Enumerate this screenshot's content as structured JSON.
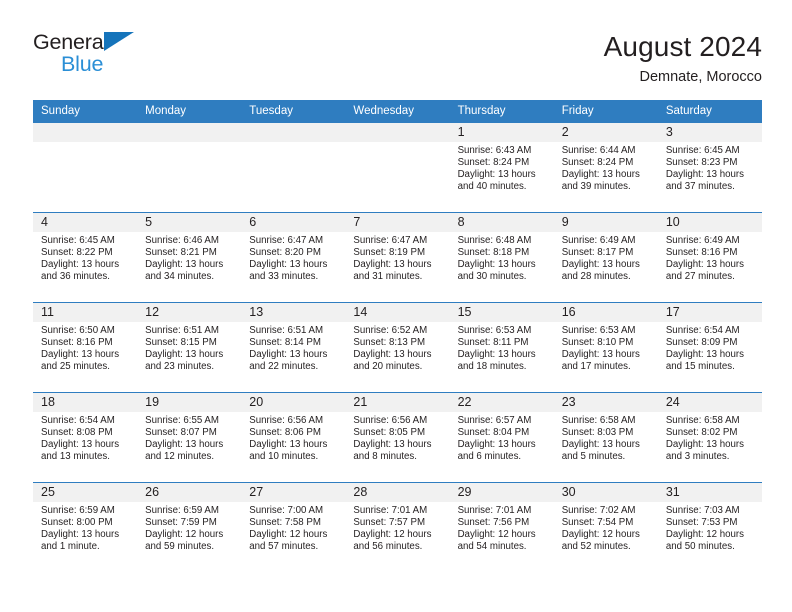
{
  "brand": {
    "name_part1": "General",
    "name_part2": "Blue",
    "triangle_color": "#1574bb",
    "blue_color": "#2b8fd6"
  },
  "header": {
    "title": "August 2024",
    "subtitle": "Demnate, Morocco"
  },
  "theme": {
    "header_bg": "#2f7dc0",
    "daynum_bg": "#f1f1f1",
    "text": "#231f20"
  },
  "weekday_headers": [
    "Sunday",
    "Monday",
    "Tuesday",
    "Wednesday",
    "Thursday",
    "Friday",
    "Saturday"
  ],
  "labels": {
    "sunrise": "Sunrise:",
    "sunset": "Sunset:",
    "daylight": "Daylight:"
  },
  "weeks": [
    [
      {
        "day": "",
        "empty": true
      },
      {
        "day": "",
        "empty": true
      },
      {
        "day": "",
        "empty": true
      },
      {
        "day": "",
        "empty": true
      },
      {
        "day": "1",
        "sunrise": "Sunrise: 6:43 AM",
        "sunset": "Sunset: 8:24 PM",
        "daylight1": "Daylight: 13 hours",
        "daylight2": "and 40 minutes."
      },
      {
        "day": "2",
        "sunrise": "Sunrise: 6:44 AM",
        "sunset": "Sunset: 8:24 PM",
        "daylight1": "Daylight: 13 hours",
        "daylight2": "and 39 minutes."
      },
      {
        "day": "3",
        "sunrise": "Sunrise: 6:45 AM",
        "sunset": "Sunset: 8:23 PM",
        "daylight1": "Daylight: 13 hours",
        "daylight2": "and 37 minutes."
      }
    ],
    [
      {
        "day": "4",
        "sunrise": "Sunrise: 6:45 AM",
        "sunset": "Sunset: 8:22 PM",
        "daylight1": "Daylight: 13 hours",
        "daylight2": "and 36 minutes."
      },
      {
        "day": "5",
        "sunrise": "Sunrise: 6:46 AM",
        "sunset": "Sunset: 8:21 PM",
        "daylight1": "Daylight: 13 hours",
        "daylight2": "and 34 minutes."
      },
      {
        "day": "6",
        "sunrise": "Sunrise: 6:47 AM",
        "sunset": "Sunset: 8:20 PM",
        "daylight1": "Daylight: 13 hours",
        "daylight2": "and 33 minutes."
      },
      {
        "day": "7",
        "sunrise": "Sunrise: 6:47 AM",
        "sunset": "Sunset: 8:19 PM",
        "daylight1": "Daylight: 13 hours",
        "daylight2": "and 31 minutes."
      },
      {
        "day": "8",
        "sunrise": "Sunrise: 6:48 AM",
        "sunset": "Sunset: 8:18 PM",
        "daylight1": "Daylight: 13 hours",
        "daylight2": "and 30 minutes."
      },
      {
        "day": "9",
        "sunrise": "Sunrise: 6:49 AM",
        "sunset": "Sunset: 8:17 PM",
        "daylight1": "Daylight: 13 hours",
        "daylight2": "and 28 minutes."
      },
      {
        "day": "10",
        "sunrise": "Sunrise: 6:49 AM",
        "sunset": "Sunset: 8:16 PM",
        "daylight1": "Daylight: 13 hours",
        "daylight2": "and 27 minutes."
      }
    ],
    [
      {
        "day": "11",
        "sunrise": "Sunrise: 6:50 AM",
        "sunset": "Sunset: 8:16 PM",
        "daylight1": "Daylight: 13 hours",
        "daylight2": "and 25 minutes."
      },
      {
        "day": "12",
        "sunrise": "Sunrise: 6:51 AM",
        "sunset": "Sunset: 8:15 PM",
        "daylight1": "Daylight: 13 hours",
        "daylight2": "and 23 minutes."
      },
      {
        "day": "13",
        "sunrise": "Sunrise: 6:51 AM",
        "sunset": "Sunset: 8:14 PM",
        "daylight1": "Daylight: 13 hours",
        "daylight2": "and 22 minutes."
      },
      {
        "day": "14",
        "sunrise": "Sunrise: 6:52 AM",
        "sunset": "Sunset: 8:13 PM",
        "daylight1": "Daylight: 13 hours",
        "daylight2": "and 20 minutes."
      },
      {
        "day": "15",
        "sunrise": "Sunrise: 6:53 AM",
        "sunset": "Sunset: 8:11 PM",
        "daylight1": "Daylight: 13 hours",
        "daylight2": "and 18 minutes."
      },
      {
        "day": "16",
        "sunrise": "Sunrise: 6:53 AM",
        "sunset": "Sunset: 8:10 PM",
        "daylight1": "Daylight: 13 hours",
        "daylight2": "and 17 minutes."
      },
      {
        "day": "17",
        "sunrise": "Sunrise: 6:54 AM",
        "sunset": "Sunset: 8:09 PM",
        "daylight1": "Daylight: 13 hours",
        "daylight2": "and 15 minutes."
      }
    ],
    [
      {
        "day": "18",
        "sunrise": "Sunrise: 6:54 AM",
        "sunset": "Sunset: 8:08 PM",
        "daylight1": "Daylight: 13 hours",
        "daylight2": "and 13 minutes."
      },
      {
        "day": "19",
        "sunrise": "Sunrise: 6:55 AM",
        "sunset": "Sunset: 8:07 PM",
        "daylight1": "Daylight: 13 hours",
        "daylight2": "and 12 minutes."
      },
      {
        "day": "20",
        "sunrise": "Sunrise: 6:56 AM",
        "sunset": "Sunset: 8:06 PM",
        "daylight1": "Daylight: 13 hours",
        "daylight2": "and 10 minutes."
      },
      {
        "day": "21",
        "sunrise": "Sunrise: 6:56 AM",
        "sunset": "Sunset: 8:05 PM",
        "daylight1": "Daylight: 13 hours",
        "daylight2": "and 8 minutes."
      },
      {
        "day": "22",
        "sunrise": "Sunrise: 6:57 AM",
        "sunset": "Sunset: 8:04 PM",
        "daylight1": "Daylight: 13 hours",
        "daylight2": "and 6 minutes."
      },
      {
        "day": "23",
        "sunrise": "Sunrise: 6:58 AM",
        "sunset": "Sunset: 8:03 PM",
        "daylight1": "Daylight: 13 hours",
        "daylight2": "and 5 minutes."
      },
      {
        "day": "24",
        "sunrise": "Sunrise: 6:58 AM",
        "sunset": "Sunset: 8:02 PM",
        "daylight1": "Daylight: 13 hours",
        "daylight2": "and 3 minutes."
      }
    ],
    [
      {
        "day": "25",
        "sunrise": "Sunrise: 6:59 AM",
        "sunset": "Sunset: 8:00 PM",
        "daylight1": "Daylight: 13 hours",
        "daylight2": "and 1 minute."
      },
      {
        "day": "26",
        "sunrise": "Sunrise: 6:59 AM",
        "sunset": "Sunset: 7:59 PM",
        "daylight1": "Daylight: 12 hours",
        "daylight2": "and 59 minutes."
      },
      {
        "day": "27",
        "sunrise": "Sunrise: 7:00 AM",
        "sunset": "Sunset: 7:58 PM",
        "daylight1": "Daylight: 12 hours",
        "daylight2": "and 57 minutes."
      },
      {
        "day": "28",
        "sunrise": "Sunrise: 7:01 AM",
        "sunset": "Sunset: 7:57 PM",
        "daylight1": "Daylight: 12 hours",
        "daylight2": "and 56 minutes."
      },
      {
        "day": "29",
        "sunrise": "Sunrise: 7:01 AM",
        "sunset": "Sunset: 7:56 PM",
        "daylight1": "Daylight: 12 hours",
        "daylight2": "and 54 minutes."
      },
      {
        "day": "30",
        "sunrise": "Sunrise: 7:02 AM",
        "sunset": "Sunset: 7:54 PM",
        "daylight1": "Daylight: 12 hours",
        "daylight2": "and 52 minutes."
      },
      {
        "day": "31",
        "sunrise": "Sunrise: 7:03 AM",
        "sunset": "Sunset: 7:53 PM",
        "daylight1": "Daylight: 12 hours",
        "daylight2": "and 50 minutes."
      }
    ]
  ]
}
